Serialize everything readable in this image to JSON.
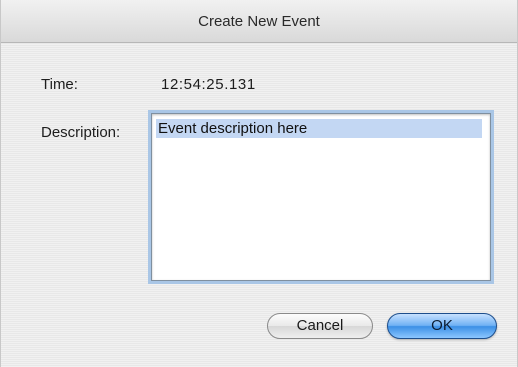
{
  "dialog": {
    "title": "Create New Event",
    "time_label": "Time:",
    "time_value": "12:54:25.131",
    "description_label": "Description:",
    "description_value": "Event description here",
    "cancel_label": "Cancel",
    "ok_label": "OK"
  },
  "colors": {
    "focus_ring": "#a9c6e6",
    "default_button": "#3b8fe6",
    "text_selection": "#c3d7f3"
  }
}
